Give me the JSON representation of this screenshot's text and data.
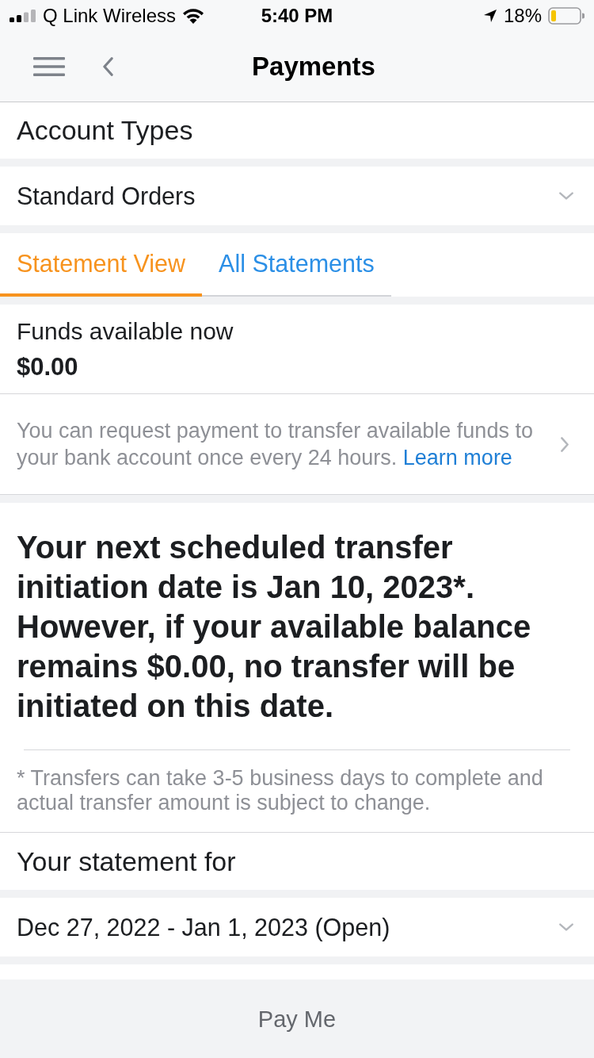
{
  "status_bar": {
    "carrier": "Q Link Wireless",
    "time": "5:40 PM",
    "battery": "18%"
  },
  "nav": {
    "title": "Payments"
  },
  "account_types": {
    "label": "Account Types",
    "dropdown": {
      "value": "Standard Orders"
    }
  },
  "tabs": [
    {
      "label": "Statement View",
      "selected": true
    },
    {
      "label": "All Statements",
      "selected": false
    }
  ],
  "funds": {
    "label": "Funds available now",
    "amount": "$0.00"
  },
  "info": {
    "text": "You can request payment to transfer available funds to your bank account once every 24 hours.",
    "link": "Learn more"
  },
  "schedule": {
    "notice": "Your next scheduled transfer initiation date is Jan 10, 2023*. However, if your available balance remains $0.00, no transfer will be initiated on this date.",
    "footnote": "* Transfers can take 3-5 business days to complete and actual transfer amount is subject to change."
  },
  "statement": {
    "label": "Your statement for",
    "dropdown": {
      "value": "Dec 27, 2022 - Jan 1, 2023 (Open)"
    }
  },
  "pay_button": {
    "label": "Pay Me"
  }
}
